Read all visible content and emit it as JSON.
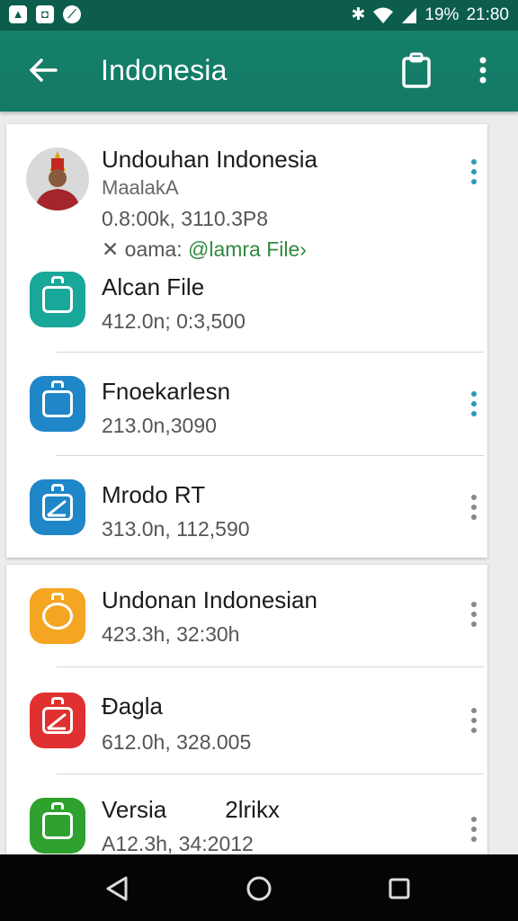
{
  "status_bar": {
    "battery": "19%",
    "time": "21:80",
    "left_icons": [
      "gallery-notification-icon",
      "photo-notification-icon",
      "compass-notification-icon"
    ],
    "right_icons": [
      "bluetooth-icon",
      "wifi-icon",
      "signal-icon"
    ]
  },
  "app_bar": {
    "title": "Indonesia",
    "color": "#137a64"
  },
  "list": {
    "card1": [
      {
        "title": "Undouhan Indonesia",
        "subtitle": "MaalakA",
        "meta": "0.8:00k, 3110.3P8",
        "extra_prefix": "✕ oama:",
        "extra_link": "@lamra File›",
        "avatar": "person-avatar"
      },
      {
        "title": "Alcan File",
        "meta": "412.0n; 0:3,500",
        "icon": "file-icon",
        "color": "#19a79a"
      },
      {
        "title": "Fnoekarlesn",
        "meta": "213.0n,3090",
        "icon": "file-icon",
        "color": "#1f86c8"
      },
      {
        "title": "Mrodo RT",
        "meta": "313.0n, 112,590",
        "icon": "edit-file-icon",
        "color": "#1f86c8"
      }
    ],
    "card2": [
      {
        "title": "Undonan Indonesian",
        "meta": "423.3h, 32:30h",
        "icon": "file-icon",
        "color": "#f4a622"
      },
      {
        "title": "Ðagla",
        "meta": "612.0h, 328.005",
        "icon": "edit-file-icon",
        "color": "#e0302f"
      },
      {
        "title": "Versia         2lrikx",
        "meta": "A12.3h, 34:2012",
        "icon": "camera-file-icon",
        "color": "#2ea12f"
      }
    ]
  },
  "accent": {
    "menu_dots_active": "#2a9ab8",
    "menu_dots_inactive": "#888888",
    "link_green": "#2e8b3e"
  }
}
